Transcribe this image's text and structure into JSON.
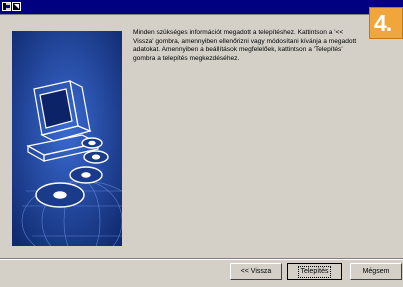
{
  "window": {
    "step_number": "4."
  },
  "message": {
    "text": "Minden szükséges információt megadott a telepítéshez. Kattintson a '<< Vissza' gombra, amennyiben ellenőrizni vagy módosítani kívánja a megadott adatokat. Amennyiben a beállítások megfelelőek, kattintson a 'Telepítés' gombra a telepítés megkezdéséhez."
  },
  "buttons": {
    "back_label": "<< Vissza",
    "install_label": "Telepítés",
    "cancel_label": "Mégsem"
  },
  "colors": {
    "window_bg": "#d4d0c8",
    "titlebar": "#000080",
    "side_panel": "#1a3a8a",
    "step_badge": "#f0a63a"
  },
  "icons": {
    "system_menu": "window-icon",
    "side_art": "computer-with-cds-illustration"
  }
}
